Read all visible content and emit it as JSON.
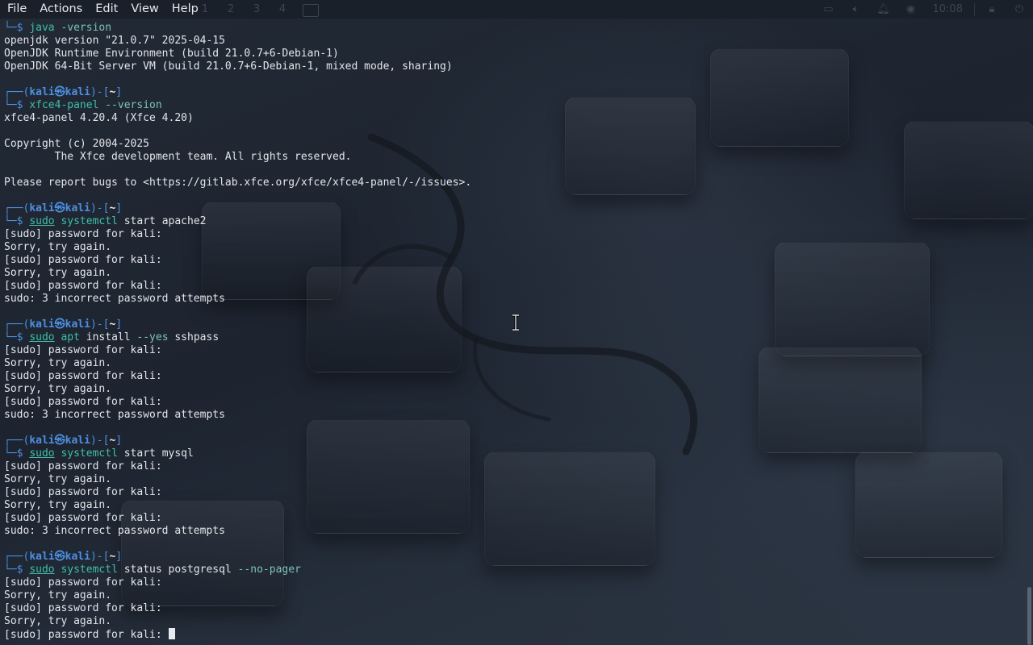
{
  "menubar": {
    "items": [
      "File",
      "Actions",
      "Edit",
      "View",
      "Help"
    ]
  },
  "panel": {
    "workspaces": [
      "1",
      "2",
      "3",
      "4"
    ],
    "clock": "10:08"
  },
  "prompt": {
    "top_prefix": "┌──(",
    "user": "kali",
    "at": "㉿",
    "host": "kali",
    "mid": ")-[",
    "path": "~",
    "close": "]",
    "bottom_prefix": "└─$ "
  },
  "terminal": {
    "first_cmd": {
      "cmd": "java",
      "args": " -version"
    },
    "java_out": [
      "openjdk version \"21.0.7\" 2025-04-15",
      "OpenJDK Runtime Environment (build 21.0.7+6-Debian-1)",
      "OpenJDK 64-Bit Server VM (build 21.0.7+6-Debian-1, mixed mode, sharing)"
    ],
    "cmd2": {
      "cmd": "xfce4-panel",
      "args": " --version"
    },
    "xfce_out": [
      "xfce4-panel 4.20.4 (Xfce 4.20)",
      "",
      "Copyright (c) 2004-2025",
      "        The Xfce development team. All rights reserved.",
      "",
      "Please report bugs to <https://gitlab.xfce.org/xfce/xfce4-panel/-/issues>."
    ],
    "cmd3": {
      "sudo": "sudo",
      "cmd": "systemctl",
      "args": " start apache2"
    },
    "cmd4": {
      "sudo": "sudo",
      "cmd": "apt",
      "args": " install ",
      "flag": "--yes",
      "tail": " sshpass"
    },
    "cmd5": {
      "sudo": "sudo",
      "cmd": "systemctl",
      "args": " start mysql"
    },
    "cmd6": {
      "sudo": "sudo",
      "cmd": "systemctl",
      "args": " status postgresql ",
      "flag": "--no-pager"
    },
    "sudo_fail_out": [
      "[sudo] password for kali:",
      "Sorry, try again.",
      "[sudo] password for kali:",
      "Sorry, try again.",
      "[sudo] password for kali:",
      "sudo: 3 incorrect password attempts"
    ],
    "last_out": [
      "[sudo] password for kali:",
      "Sorry, try again.",
      "[sudo] password for kali:",
      "Sorry, try again."
    ],
    "current_prompt": "[sudo] password for kali: "
  },
  "colors": {
    "prompt_frame": "#4d8fe0",
    "command": "#3fbfa8",
    "text": "#e3e6ea",
    "background": "#1b212c"
  }
}
